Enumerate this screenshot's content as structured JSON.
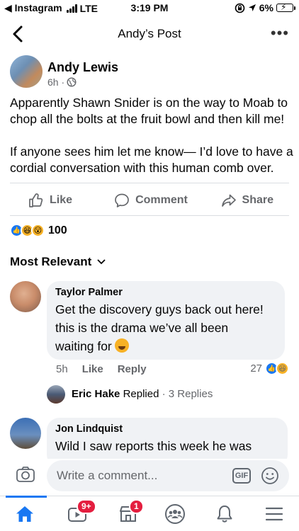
{
  "status_bar": {
    "back_app": "◀ Instagram",
    "carrier": "LTE",
    "time": "3:19 PM",
    "battery": "6%"
  },
  "header": {
    "title": "Andy’s Post"
  },
  "post": {
    "author": "Andy Lewis",
    "time": "6h ·",
    "paragraphs": [
      "Apparently Shawn Snider is on the way to Moab to chop all the bolts at the fruit bowl and then kill me!",
      "If anyone sees him let me know— I’d love to have a cordial conversation with this human comb over."
    ],
    "actions": {
      "like": "Like",
      "comment": "Comment",
      "share": "Share"
    },
    "reaction_count": "100"
  },
  "comments_section": {
    "sort_label": "Most Relevant"
  },
  "comments": [
    {
      "author": "Taylor Palmer",
      "lines": [
        "Get the discovery guys back out here!",
        "this is the drama we’ve all been",
        "waiting for"
      ],
      "time": "5h",
      "like": "Like",
      "reply": "Reply",
      "reactions": "27",
      "reply_summary": {
        "author": "Eric Hake",
        "verb": "Replied",
        "dot": "·",
        "count": "3 Replies"
      }
    },
    {
      "author": "Jon Lindquist",
      "lines": [
        "Wild I saw reports this week he was"
      ]
    }
  ],
  "composer": {
    "placeholder": "Write a comment...",
    "gif": "GIF"
  },
  "nav": {
    "watch_badge": "9+",
    "marketplace_badge": "1"
  },
  "colors": {
    "accent": "#1877f2",
    "badge": "#e41e3f",
    "muted_text": "#65676b",
    "bubble": "#f0f2f5"
  }
}
